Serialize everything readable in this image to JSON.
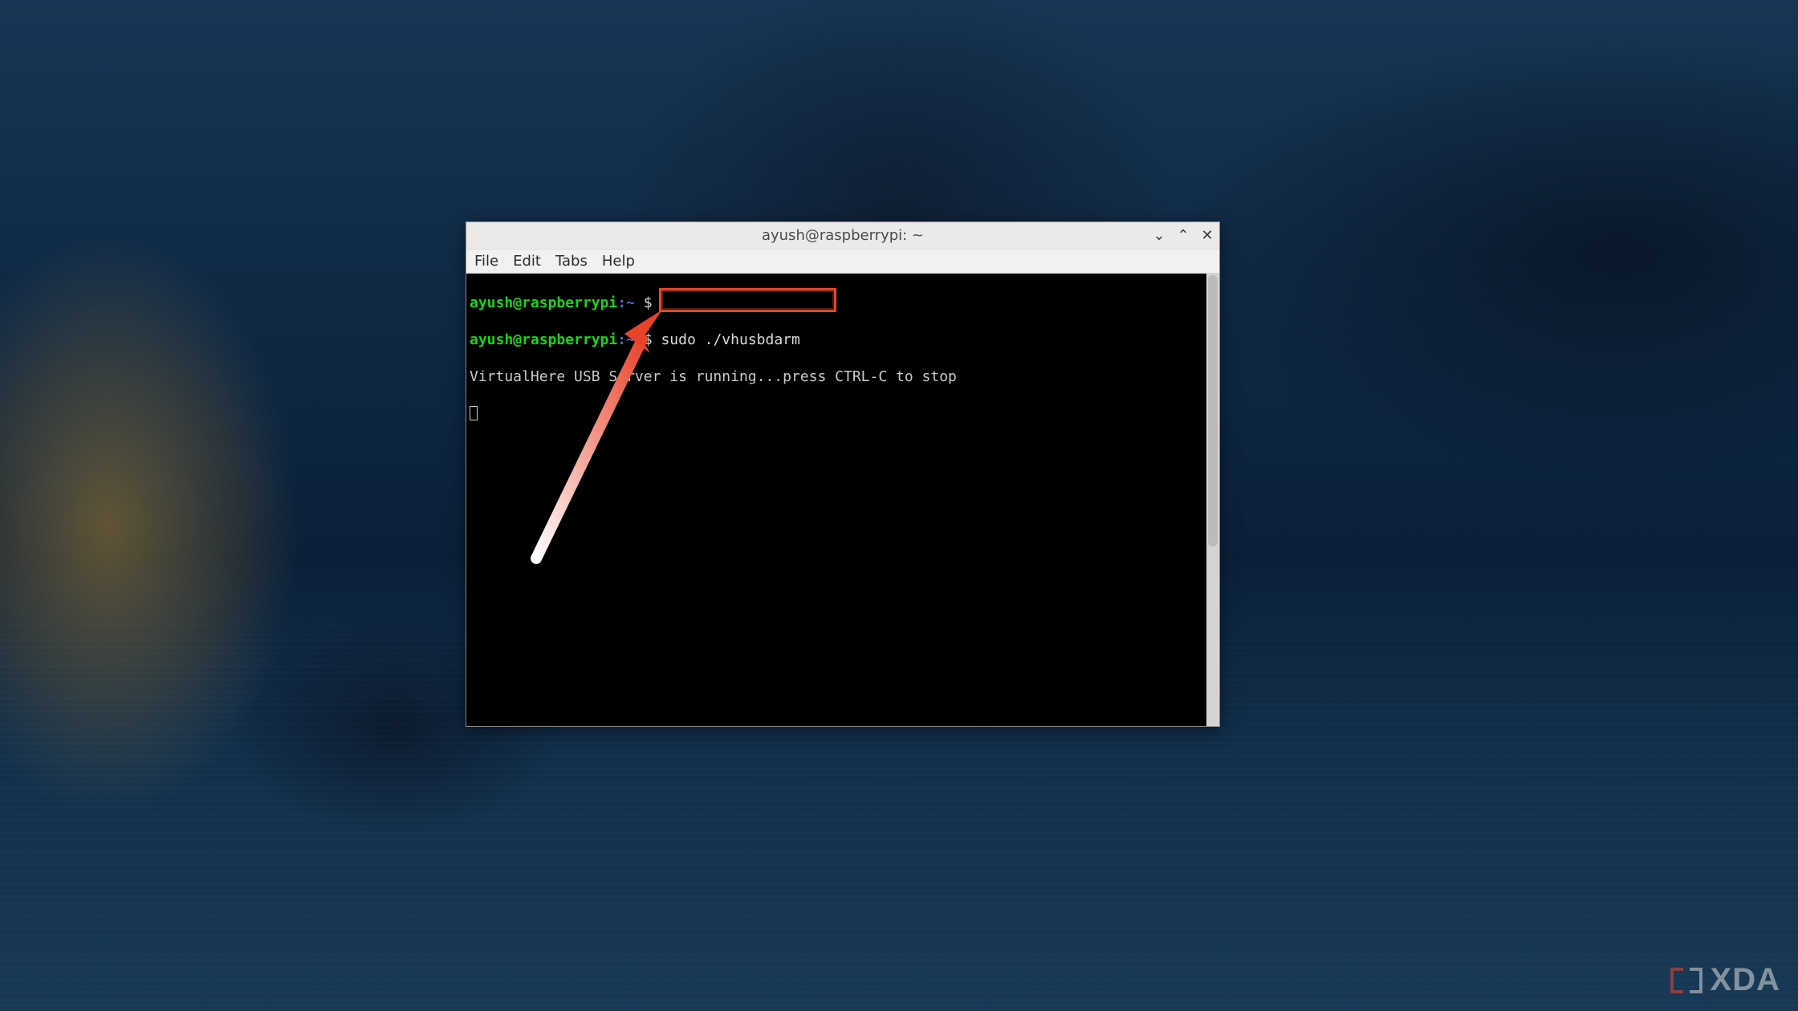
{
  "window": {
    "title": "ayush@raspberrypi: ~",
    "controls": {
      "min": "⌄",
      "max": "⌃",
      "close": "✕"
    }
  },
  "menubar": {
    "file": "File",
    "edit": "Edit",
    "tabs": "Tabs",
    "help": "Help"
  },
  "terminal": {
    "lines": [
      {
        "user": "ayush@raspberrypi",
        "path": "~",
        "sym": "$",
        "cmd": ""
      },
      {
        "user": "ayush@raspberrypi",
        "path": "~",
        "sym": "$",
        "cmd": "sudo ./vhusbdarm"
      }
    ],
    "output": "VirtualHere USB Server is running...press CTRL-C to stop",
    "highlighted_command": "sudo ./vhusbdarm"
  },
  "watermark": {
    "text": "XDA"
  }
}
